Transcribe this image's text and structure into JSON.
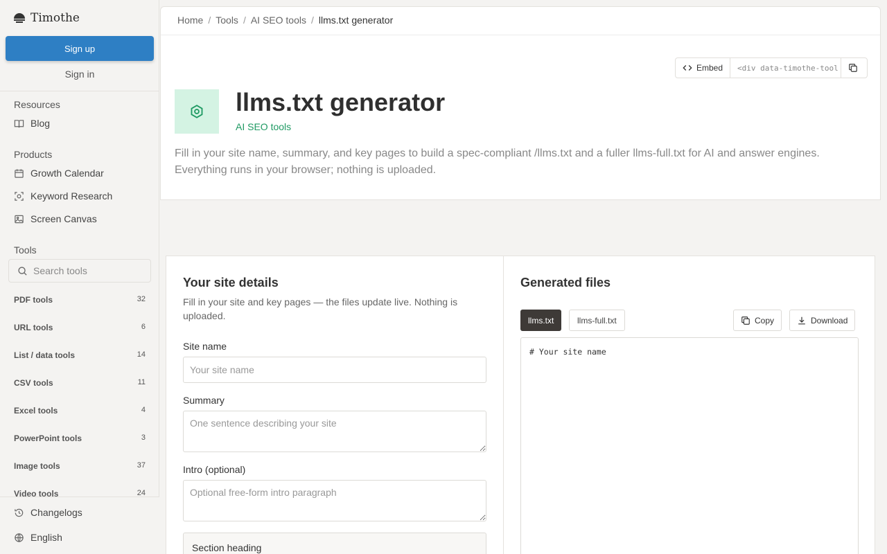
{
  "brand": {
    "name": "Timothe"
  },
  "auth": {
    "signup_label": "Sign up",
    "signin_label": "Sign in"
  },
  "sidebar": {
    "resources": {
      "heading": "Resources",
      "items": [
        {
          "label": "Blog",
          "icon": "book-icon"
        }
      ]
    },
    "products": {
      "heading": "Products",
      "items": [
        {
          "label": "Growth Calendar",
          "icon": "calendar-icon"
        },
        {
          "label": "Keyword Research",
          "icon": "scan-icon"
        },
        {
          "label": "Screen Canvas",
          "icon": "image-icon"
        }
      ]
    },
    "tools": {
      "heading": "Tools",
      "search_placeholder": "Search tools",
      "categories": [
        {
          "label": "PDF tools",
          "count": "32"
        },
        {
          "label": "URL tools",
          "count": "6"
        },
        {
          "label": "List / data tools",
          "count": "14"
        },
        {
          "label": "CSV tools",
          "count": "11"
        },
        {
          "label": "Excel tools",
          "count": "4"
        },
        {
          "label": "PowerPoint tools",
          "count": "3"
        },
        {
          "label": "Image tools",
          "count": "37"
        },
        {
          "label": "Video tools",
          "count": "24"
        }
      ]
    },
    "footer": {
      "changelogs": "Changelogs",
      "language": "English"
    }
  },
  "breadcrumb": [
    "Home",
    "Tools",
    "AI SEO tools",
    "llms.txt generator"
  ],
  "embed": {
    "label": "Embed",
    "code": "<div data-timothe-tool"
  },
  "page": {
    "title": "llms.txt generator",
    "category": "AI SEO tools",
    "description": "Fill in your site name, summary, and key pages to build a spec-compliant /llms.txt and a fuller llms-full.txt for AI and answer engines. Everything runs in your browser; nothing is uploaded."
  },
  "form": {
    "title": "Your site details",
    "subtitle": "Fill in your site and key pages — the files update live. Nothing is uploaded.",
    "site_name": {
      "label": "Site name",
      "placeholder": "Your site name",
      "value": ""
    },
    "summary": {
      "label": "Summary",
      "placeholder": "One sentence describing your site",
      "value": ""
    },
    "intro": {
      "label": "Intro (optional)",
      "placeholder": "Optional free-form intro paragraph",
      "value": ""
    },
    "section_heading": "Section heading"
  },
  "output": {
    "title": "Generated files",
    "tabs": [
      {
        "label": "llms.txt",
        "active": true
      },
      {
        "label": "llms-full.txt",
        "active": false
      }
    ],
    "copy_label": "Copy",
    "download_label": "Download",
    "content": "# Your site name"
  },
  "colors": {
    "accent": "#2e7fc4",
    "category": "#1f9a63",
    "icon_bg": "#d4f3e3",
    "tab_active": "#3e3a37"
  }
}
